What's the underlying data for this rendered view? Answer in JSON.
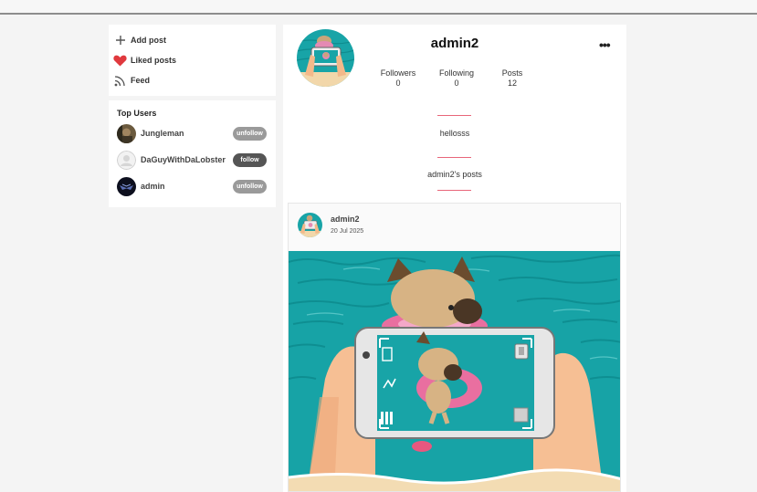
{
  "sidebar": {
    "menu": [
      {
        "label": "Add post",
        "icon": "plus-icon"
      },
      {
        "label": "Liked posts",
        "icon": "heart-icon"
      },
      {
        "label": "Feed",
        "icon": "rss-icon"
      }
    ],
    "top_users_title": "Top Users",
    "top_users": [
      {
        "name": "Jungleman",
        "action": "unfollow"
      },
      {
        "name": "DaGuyWithDaLobster",
        "action": "follow"
      },
      {
        "name": "admin",
        "action": "unfollow"
      }
    ]
  },
  "profile": {
    "username": "admin2",
    "menu_icon": "more-horizontal-icon",
    "stats": [
      {
        "label": "Followers",
        "value": "0"
      },
      {
        "label": "Following",
        "value": "0"
      },
      {
        "label": "Posts",
        "value": "12"
      }
    ],
    "bio": "hellosss",
    "posts_heading": "admin2's posts"
  },
  "post": {
    "username": "admin2",
    "date": "20 Jul 2025"
  },
  "colors": {
    "accent_line": "#e8667a",
    "heart": "#e0393e",
    "water": "#17a3a6",
    "follow_pill": "#555555",
    "unfollow_pill": "#9a9a9a"
  }
}
